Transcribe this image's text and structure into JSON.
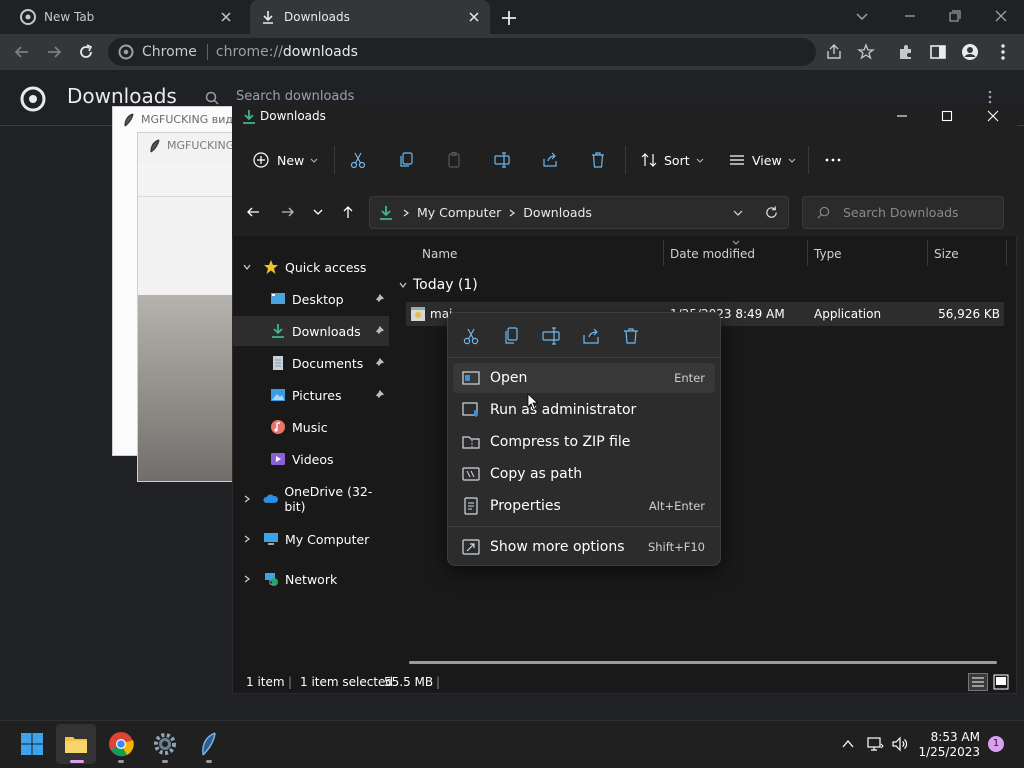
{
  "chrome": {
    "tabs": [
      {
        "label": "New Tab",
        "active": false
      },
      {
        "label": "Downloads",
        "active": true
      }
    ],
    "omnibox": {
      "site": "Chrome",
      "url_scheme": "chrome://",
      "url_path": "downloads"
    }
  },
  "downloads_page": {
    "title": "Downloads",
    "search_placeholder": "Search downloads"
  },
  "background_windows": [
    "MGFUCKING вид",
    "MGFUCKING"
  ],
  "explorer": {
    "title": "Downloads",
    "commands": {
      "new": "New",
      "sort": "Sort",
      "view": "View"
    },
    "breadcrumb": [
      "My Computer",
      "Downloads"
    ],
    "search_placeholder": "Search Downloads",
    "nav": {
      "quick_access": "Quick access",
      "items": [
        {
          "label": "Desktop",
          "pinned": true
        },
        {
          "label": "Downloads",
          "pinned": true,
          "selected": true
        },
        {
          "label": "Documents",
          "pinned": true
        },
        {
          "label": "Pictures",
          "pinned": true
        },
        {
          "label": "Music",
          "pinned": false
        },
        {
          "label": "Videos",
          "pinned": false
        }
      ],
      "onedrive": "OneDrive (32-bit)",
      "my_computer": "My Computer",
      "network": "Network"
    },
    "columns": [
      "Name",
      "Date modified",
      "Type",
      "Size"
    ],
    "group": "Today (1)",
    "file": {
      "name": "mai",
      "date": "1/25/2023 8:49 AM",
      "type": "Application",
      "size": "56,926 KB"
    },
    "status": {
      "count": "1 item",
      "selected": "1 item selected",
      "size": "55.5 MB"
    }
  },
  "context_menu": {
    "quick_actions": [
      "cut-icon",
      "copy-icon",
      "rename-icon",
      "share-icon",
      "delete-icon"
    ],
    "items": [
      {
        "label": "Open",
        "shortcut": "Enter"
      },
      {
        "label": "Run as administrator",
        "shortcut": ""
      },
      {
        "label": "Compress to ZIP file",
        "shortcut": ""
      },
      {
        "label": "Copy as path",
        "shortcut": ""
      },
      {
        "label": "Properties",
        "shortcut": "Alt+Enter"
      },
      {
        "label": "Show more options",
        "shortcut": "Shift+F10"
      }
    ]
  },
  "taskbar": {
    "time": "8:53 AM",
    "date": "1/25/2023",
    "notification_count": "1"
  },
  "colors": {
    "accent": "#0078d4",
    "explorer_bg": "#191919",
    "chrome_dark": "#202124",
    "chrome_toolbar": "#35363a"
  }
}
